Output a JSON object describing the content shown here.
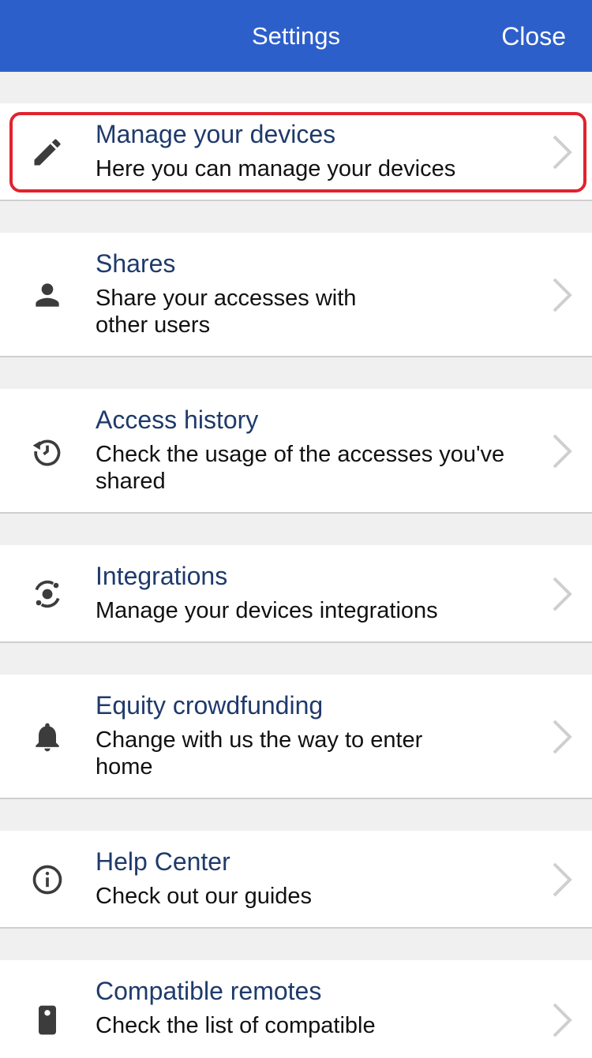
{
  "header": {
    "title": "Settings",
    "close_label": "Close"
  },
  "items": [
    {
      "label": "Manage your devices",
      "description": "Here you can manage your devices",
      "icon": "pencil-icon"
    },
    {
      "label": "Shares",
      "description": "Share your accesses with other users",
      "icon": "person-icon"
    },
    {
      "label": "Access history",
      "description": "Check the usage of the accesses you've shared",
      "icon": "history-icon"
    },
    {
      "label": "Integrations",
      "description": "Manage your devices integrations",
      "icon": "integrations-icon"
    },
    {
      "label": "Equity crowdfunding",
      "description": "Change with us the way to enter home",
      "icon": "bell-icon"
    },
    {
      "label": "Help Center",
      "description": "Check out our guides",
      "icon": "info-icon"
    },
    {
      "label": "Compatible remotes",
      "description": "Check the list of compatible",
      "icon": "remote-icon"
    }
  ],
  "colors": {
    "header_bg": "#2d5fcb",
    "label": "#1f3a6b",
    "highlight_border": "#e0232e"
  }
}
